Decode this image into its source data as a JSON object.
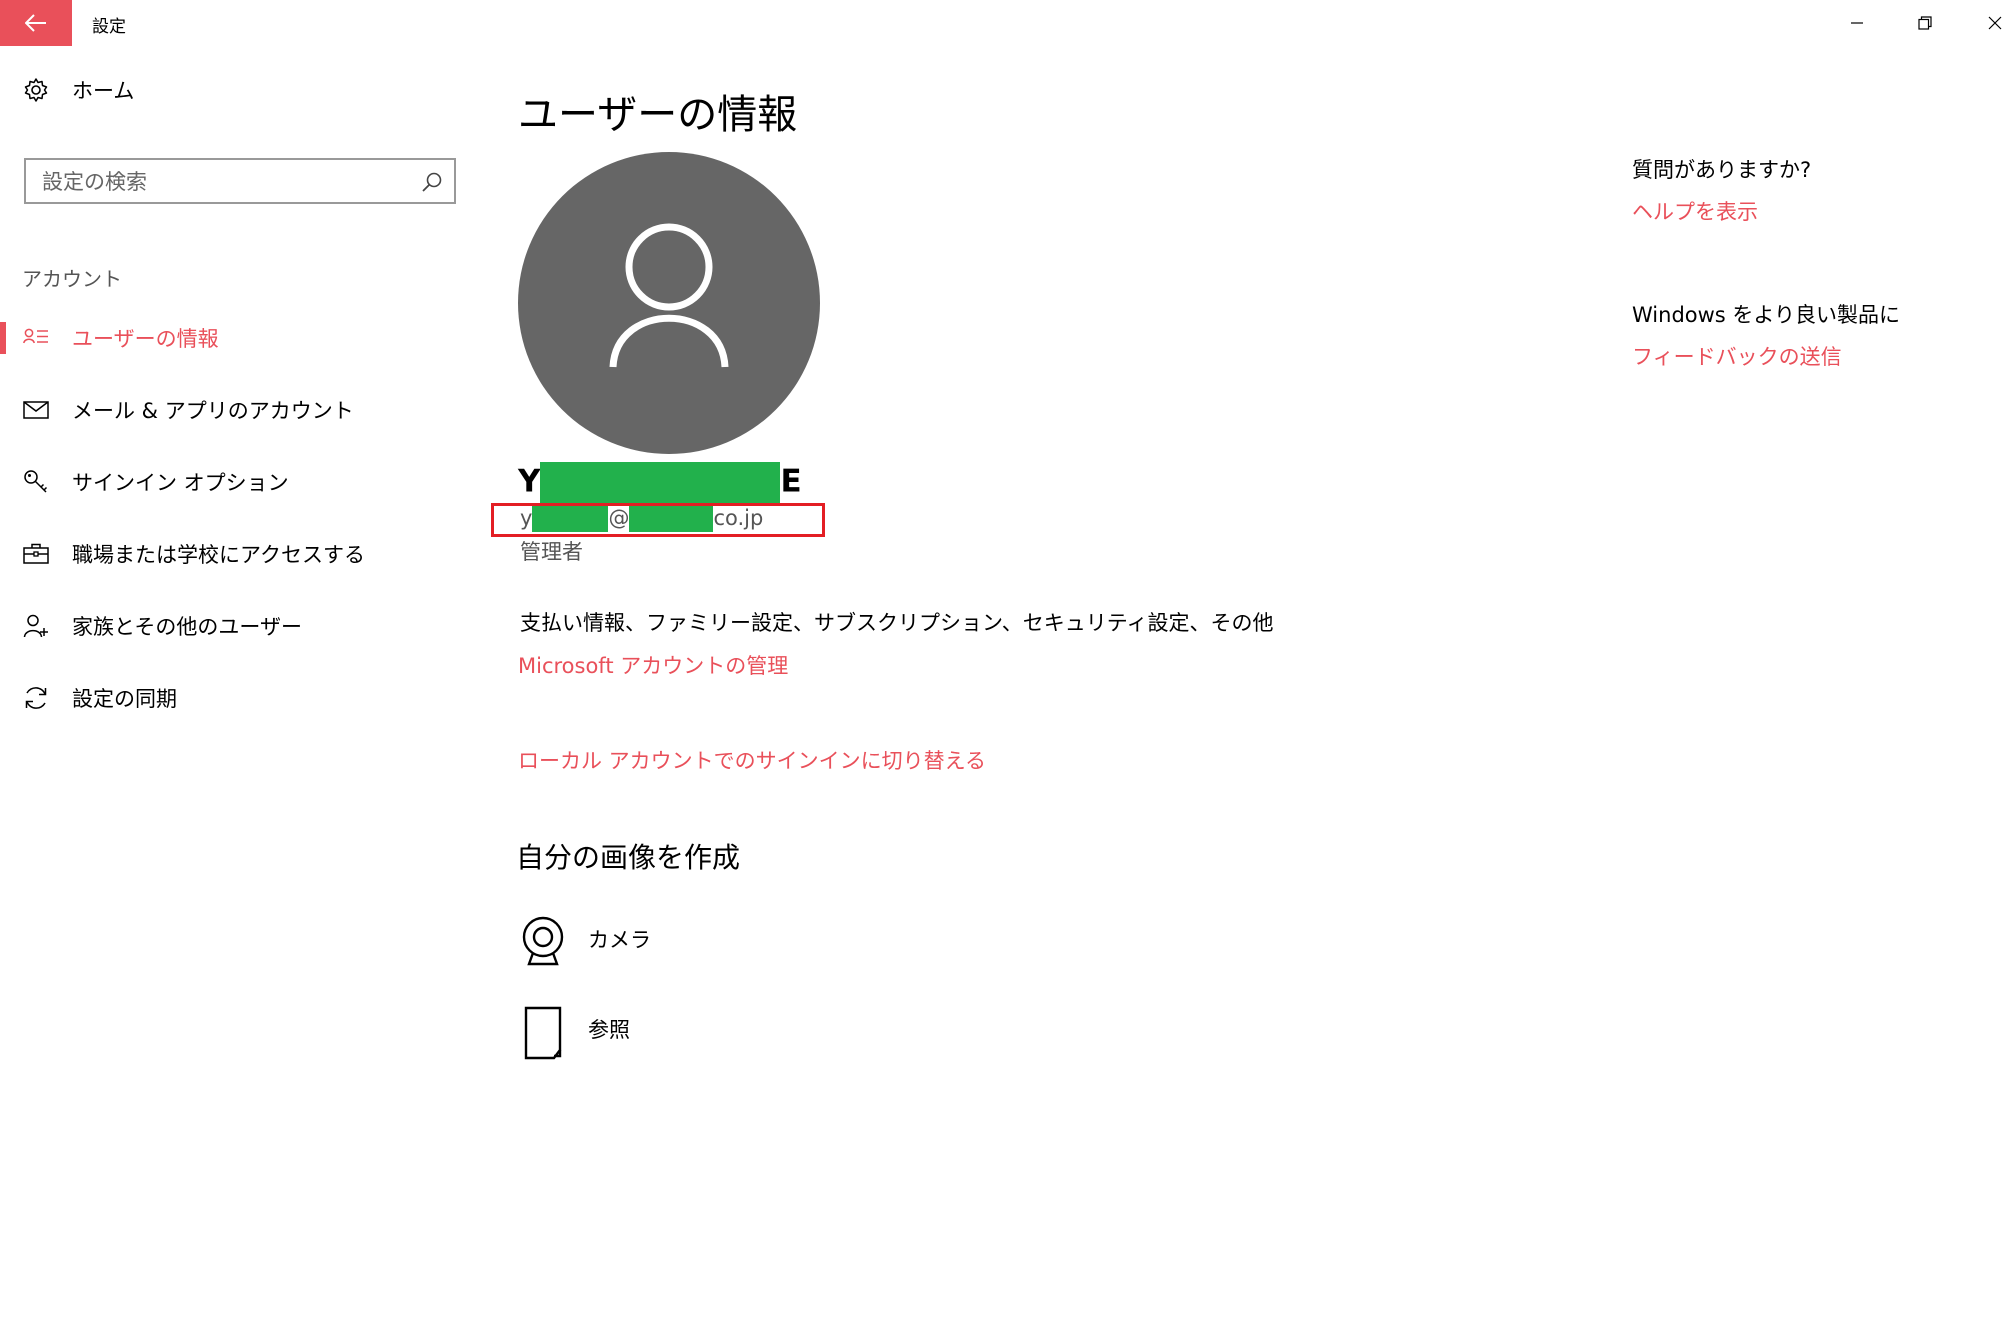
{
  "titlebar": {
    "title": "設定",
    "back_icon": "back-arrow-icon",
    "controls": [
      "minimize-icon",
      "restore-icon",
      "close-icon"
    ]
  },
  "sidebar": {
    "home_label": "ホーム",
    "search_placeholder": "設定の検索",
    "section_title": "アカウント",
    "items": [
      {
        "label": "ユーザーの情報",
        "icon": "user-info-icon",
        "active": true
      },
      {
        "label": "メール & アプリのアカウント",
        "icon": "mail-icon",
        "active": false
      },
      {
        "label": "サインイン オプション",
        "icon": "key-icon",
        "active": false
      },
      {
        "label": "職場または学校にアクセスする",
        "icon": "briefcase-icon",
        "active": false
      },
      {
        "label": "家族とその他のユーザー",
        "icon": "add-user-icon",
        "active": false
      },
      {
        "label": "設定の同期",
        "icon": "sync-icon",
        "active": false
      }
    ]
  },
  "main": {
    "page_title": "ユーザーの情報",
    "user_name_start": "Y",
    "user_name_end": "E",
    "email_parts": [
      "y",
      "@",
      "co.jp"
    ],
    "role": "管理者",
    "description": "支払い情報、ファミリー設定、サブスクリプション、セキュリティ設定、その他",
    "manage_link": "Microsoft アカウントの管理",
    "local_link": "ローカル アカウントでのサインインに切り替える",
    "picture_title": "自分の画像を作成",
    "options": [
      {
        "label": "カメラ",
        "icon": "webcam-icon"
      },
      {
        "label": "参照",
        "icon": "browse-file-icon"
      }
    ]
  },
  "right": {
    "question": "質問がありますか?",
    "help_link": "ヘルプを表示",
    "feedback_text": "Windows をより良い製品に",
    "feedback_link": "フィードバックの送信"
  },
  "colors": {
    "accent": "#e9505a",
    "avatar_bg": "#666666",
    "redaction": "#22b14c",
    "highlight_box": "#e31e24"
  }
}
